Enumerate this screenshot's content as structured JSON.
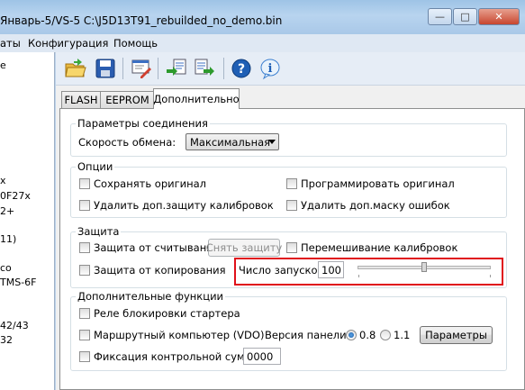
{
  "window": {
    "title": "Январь-5/VS-5 C:\\J5D13T91_rebuilded_no_demo.bin",
    "minimize_label": "—",
    "maximize_label": "□",
    "close_label": "✕"
  },
  "menu": {
    "items": [
      "аты",
      "Конфигурация",
      "Помощь"
    ]
  },
  "left_panel": {
    "items": [
      "e",
      "x",
      "0F27x",
      "2+",
      "11)",
      "co",
      "TMS-6F",
      "42/43",
      "32"
    ]
  },
  "toolbar": {
    "buttons": [
      "open-folder-icon",
      "save-disk-icon",
      "edit-settings-icon",
      "read-ecu-icon",
      "write-ecu-icon",
      "help-icon",
      "info-icon"
    ]
  },
  "tabs": {
    "items": [
      "FLASH",
      "EEPROM",
      "Дополнительно"
    ],
    "active": "Дополнительно"
  },
  "connection": {
    "group_title": "Параметры соединения",
    "speed_label": "Скорость обмена:",
    "speed_value": "Максимальная"
  },
  "options": {
    "group_title": "Опции",
    "save_original": "Сохранять оригинал",
    "program_original": "Программировать оригинал",
    "remove_calib_protection": "Удалить доп.защиту калибровок",
    "remove_error_mask": "Удалить доп.маску ошибок"
  },
  "protection": {
    "group_title": "Защита",
    "read_protection": "Защита от считывания",
    "remove_protection_button": "Снять защиту",
    "shuffle_calibrations": "Перемешивание калибровок",
    "copy_protection": "Защита от копирования",
    "launch_count_label": "Число запусков:",
    "launch_count_value": "100",
    "launch_slider_value": 0.5
  },
  "extra": {
    "group_title": "Дополнительные функции",
    "starter_relay": "Реле блокировки стартера",
    "trip_computer": "Маршрутный компьютер (VDO)",
    "panel_version_label": "Версия панели:",
    "version_options": [
      "0.8",
      "1.1"
    ],
    "version_selected": "0.8",
    "params_button": "Параметры",
    "checksum_fix": "Фиксация контрольной суммы",
    "checksum_value": "0000"
  },
  "colors": {
    "highlight_box": "#e0101a",
    "title_bar": "#b8d4ef"
  }
}
